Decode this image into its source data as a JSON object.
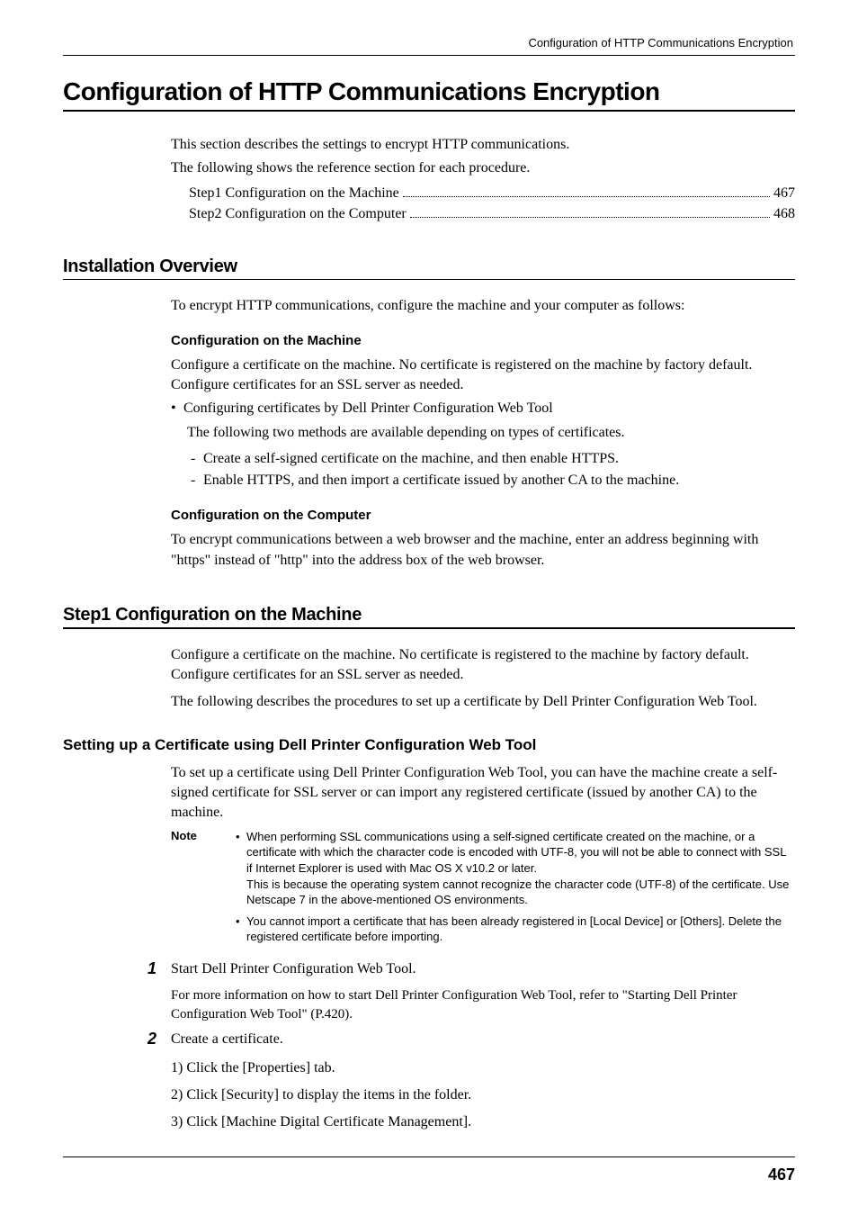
{
  "running_header": "Configuration of HTTP Communications Encryption",
  "title": "Configuration of HTTP Communications Encryption",
  "intro_p1": "This section describes the settings to encrypt HTTP communications.",
  "intro_p2": "The following shows the reference section for each procedure.",
  "toc": [
    {
      "label": "Step1 Configuration on the Machine",
      "page": "467"
    },
    {
      "label": "Step2 Configuration on the Computer",
      "page": "468"
    }
  ],
  "installation": {
    "heading": "Installation Overview",
    "lead": "To encrypt HTTP communications, configure the machine and your computer as follows:",
    "machine": {
      "heading": "Configuration on the Machine",
      "p1": "Configure a certificate on the machine. No certificate is registered on the machine by factory default. Configure certificates for an SSL server as needed.",
      "bullet": "Configuring certificates by Dell Printer Configuration Web Tool",
      "sub_lead": "The following two methods are available depending on types of certificates.",
      "dashes": [
        "Create a self-signed certificate on the machine, and then enable HTTPS.",
        "Enable HTTPS, and then import a certificate issued by another CA to the machine."
      ]
    },
    "computer": {
      "heading": "Configuration on the Computer",
      "p1": "To encrypt communications between a web browser and the machine, enter an address beginning with \"https\" instead of \"http\" into the address box of the web browser."
    }
  },
  "step1": {
    "heading": "Step1 Configuration on the Machine",
    "p1": "Configure a certificate on the machine. No certificate is registered to the machine by factory default. Configure certificates for an SSL server as needed.",
    "p2": "The following describes the procedures to set up a certificate by Dell Printer Configuration Web Tool.",
    "sub_heading": "Setting up a Certificate using Dell Printer Configuration Web Tool",
    "sub_p1": "To set up a certificate using Dell Printer Configuration Web Tool, you can have the machine create a self-signed certificate for SSL server or can import any registered certificate (issued by another CA) to the machine.",
    "note_label": "Note",
    "notes": [
      "When performing SSL communications using a self-signed certificate created on the machine, or a certificate with which the character code is encoded with UTF-8, you will not be able to connect with SSL if Internet Explorer is used with Mac OS X v10.2 or later.\nThis is because the operating system cannot recognize the character code (UTF-8) of the certificate. Use Netscape 7 in the above-mentioned OS environments.",
      "You cannot import a certificate that has been already registered in [Local Device] or [Others]. Delete the registered certificate before importing."
    ],
    "steps": [
      {
        "num": "1",
        "text": "Start Dell Printer Configuration Web Tool.",
        "after": "For more information on how to start Dell Printer Configuration Web Tool, refer to \"Starting Dell Printer Configuration Web Tool\" (P.420)."
      },
      {
        "num": "2",
        "text": "Create a certificate.",
        "subs": [
          "1) Click the [Properties] tab.",
          "2) Click [Security] to display the items in the folder.",
          "3) Click [Machine Digital Certificate Management]."
        ]
      }
    ]
  },
  "page_number": "467"
}
